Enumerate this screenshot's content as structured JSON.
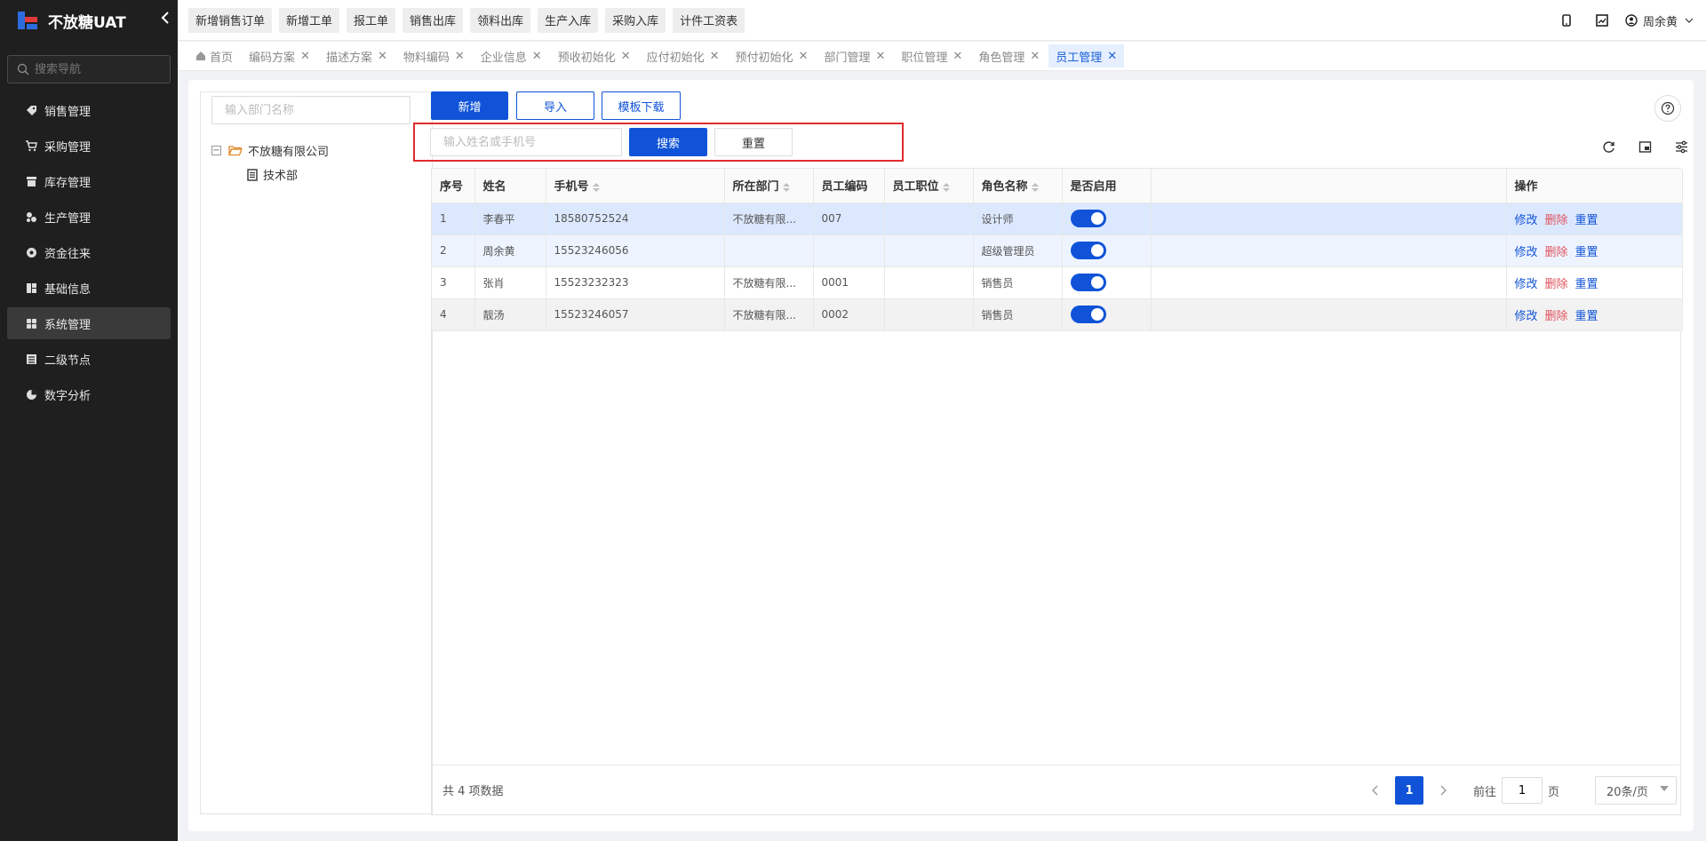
{
  "app": {
    "title": "不放糖UAT"
  },
  "nav": {
    "search_placeholder": "搜索导航",
    "items": [
      {
        "label": "销售管理",
        "icon": "tag-icon"
      },
      {
        "label": "采购管理",
        "icon": "cart-icon"
      },
      {
        "label": "库存管理",
        "icon": "warehouse-icon"
      },
      {
        "label": "生产管理",
        "icon": "production-icon"
      },
      {
        "label": "资金往来",
        "icon": "funds-icon"
      },
      {
        "label": "基础信息",
        "icon": "info-icon"
      },
      {
        "label": "系统管理",
        "icon": "grid-icon"
      },
      {
        "label": "二级节点",
        "icon": "node-icon"
      },
      {
        "label": "数字分析",
        "icon": "pie-chart-icon"
      }
    ]
  },
  "quick_actions": [
    "新增销售订单",
    "新增工单",
    "报工单",
    "销售出库",
    "领料出库",
    "生产入库",
    "采购入库",
    "计件工资表"
  ],
  "user": {
    "name": "周余黄"
  },
  "tabs": [
    {
      "label": "首页",
      "closable": false
    },
    {
      "label": "编码方案",
      "closable": true
    },
    {
      "label": "描述方案",
      "closable": true
    },
    {
      "label": "物料编码",
      "closable": true
    },
    {
      "label": "企业信息",
      "closable": true
    },
    {
      "label": "预收初始化",
      "closable": true
    },
    {
      "label": "应付初始化",
      "closable": true
    },
    {
      "label": "预付初始化",
      "closable": true
    },
    {
      "label": "部门管理",
      "closable": true
    },
    {
      "label": "职位管理",
      "closable": true
    },
    {
      "label": "角色管理",
      "closable": true
    },
    {
      "label": "员工管理",
      "closable": true
    }
  ],
  "tree": {
    "search_placeholder": "输入部门名称",
    "root": "不放糖有限公司",
    "children": [
      "技术部"
    ]
  },
  "toolbar": {
    "add": "新增",
    "import": "导入",
    "template": "模板下载"
  },
  "search": {
    "placeholder": "输入姓名或手机号",
    "search": "搜索",
    "reset": "重置"
  },
  "table": {
    "columns": [
      "序号",
      "姓名",
      "手机号",
      "所在部门",
      "员工编码",
      "员工职位",
      "角色名称",
      "是否启用",
      "",
      "操作"
    ],
    "rows": [
      {
        "no": "1",
        "name": "李春平",
        "phone": "18580752524",
        "dept": "不放糖有限...",
        "code": "007",
        "position": "",
        "role": "设计师",
        "enabled": true
      },
      {
        "no": "2",
        "name": "周余黄",
        "phone": "15523246056",
        "dept": "",
        "code": "",
        "position": "",
        "role": "超级管理员",
        "enabled": true
      },
      {
        "no": "3",
        "name": "张肖",
        "phone": "15523232323",
        "dept": "不放糖有限...",
        "code": "0001",
        "position": "",
        "role": "销售员",
        "enabled": true
      },
      {
        "no": "4",
        "name": "靓汤",
        "phone": "15523246057",
        "dept": "不放糖有限...",
        "code": "0002",
        "position": "",
        "role": "销售员",
        "enabled": true
      }
    ],
    "actions": {
      "edit": "修改",
      "delete": "删除",
      "reset": "重置"
    }
  },
  "footer": {
    "total": "共 4 项数据",
    "current_page": "1",
    "goto_label": "前往",
    "goto_value": "1",
    "page_unit": "页",
    "page_size": "20条/页"
  },
  "colors": {
    "primary": "#1053d8",
    "danger": "#e0525c",
    "highlight": "#e12b2b",
    "sidebar": "#1f1f1f"
  }
}
